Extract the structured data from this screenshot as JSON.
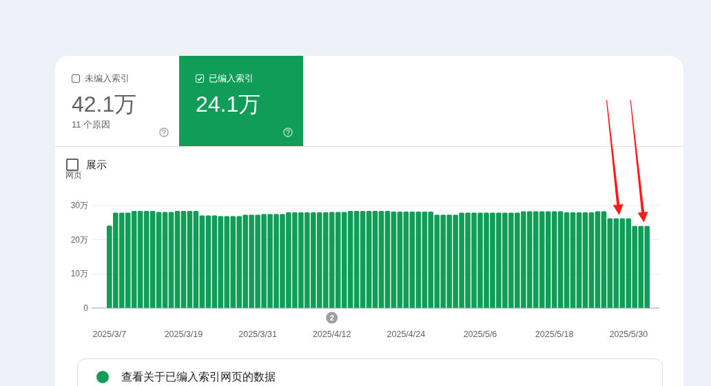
{
  "tabs": [
    {
      "label": "未编入索引",
      "value": "42.1万",
      "note": "11 个原因",
      "selected": false
    },
    {
      "label": "已编入索引",
      "value": "24.1万",
      "selected": true
    }
  ],
  "impressions": {
    "label": "展示",
    "checked": false
  },
  "chart_data": {
    "type": "bar",
    "ylabel": "网页",
    "ylim": [
      0,
      30
    ],
    "yticks": [
      {
        "value": 0,
        "label": "0"
      },
      {
        "value": 10,
        "label": "10万"
      },
      {
        "value": 20,
        "label": "20万"
      },
      {
        "value": 30,
        "label": "30万"
      }
    ],
    "categories": [
      "2025/3/7",
      null,
      null,
      null,
      null,
      null,
      null,
      null,
      null,
      null,
      null,
      null,
      "2025/3/19",
      null,
      null,
      null,
      null,
      null,
      null,
      null,
      null,
      null,
      null,
      null,
      "2025/3/31",
      null,
      null,
      null,
      null,
      null,
      null,
      null,
      null,
      null,
      null,
      null,
      "2025/4/12",
      null,
      null,
      null,
      null,
      null,
      null,
      null,
      null,
      null,
      null,
      null,
      "2025/4/24",
      null,
      null,
      null,
      null,
      null,
      null,
      null,
      null,
      null,
      null,
      null,
      "2025/5/6",
      null,
      null,
      null,
      null,
      null,
      null,
      null,
      null,
      null,
      null,
      null,
      "2025/5/18",
      null,
      null,
      null,
      null,
      null,
      null,
      null,
      null,
      null,
      null,
      null,
      "2025/5/30",
      null,
      null,
      null
    ],
    "values": [
      24.1,
      27.9,
      27.9,
      27.9,
      28.4,
      28.4,
      28.4,
      28.4,
      28.1,
      28.1,
      28.1,
      28.4,
      28.4,
      28.4,
      28.4,
      27.1,
      27.1,
      27.1,
      26.9,
      26.9,
      26.9,
      26.9,
      27.3,
      27.3,
      27.3,
      27.5,
      27.5,
      27.5,
      27.5,
      28.0,
      28.0,
      28.0,
      28.0,
      28.0,
      28.0,
      28.0,
      28.1,
      28.1,
      28.1,
      28.4,
      28.4,
      28.4,
      28.4,
      28.4,
      28.4,
      28.4,
      28.2,
      28.2,
      28.2,
      28.2,
      28.2,
      28.2,
      28.2,
      27.3,
      27.3,
      27.3,
      27.3,
      27.9,
      27.9,
      27.9,
      27.9,
      27.9,
      27.9,
      27.9,
      27.9,
      27.9,
      27.9,
      28.3,
      28.3,
      28.3,
      28.3,
      28.3,
      28.3,
      28.3,
      28.0,
      28.0,
      28.0,
      28.0,
      28.0,
      28.3,
      28.3,
      26.2,
      26.2,
      26.2,
      26.2,
      24.0,
      24.0,
      24.0
    ],
    "annotations": [
      "2"
    ]
  },
  "details": {
    "title": "查看关于已编入索引网页的数据"
  }
}
